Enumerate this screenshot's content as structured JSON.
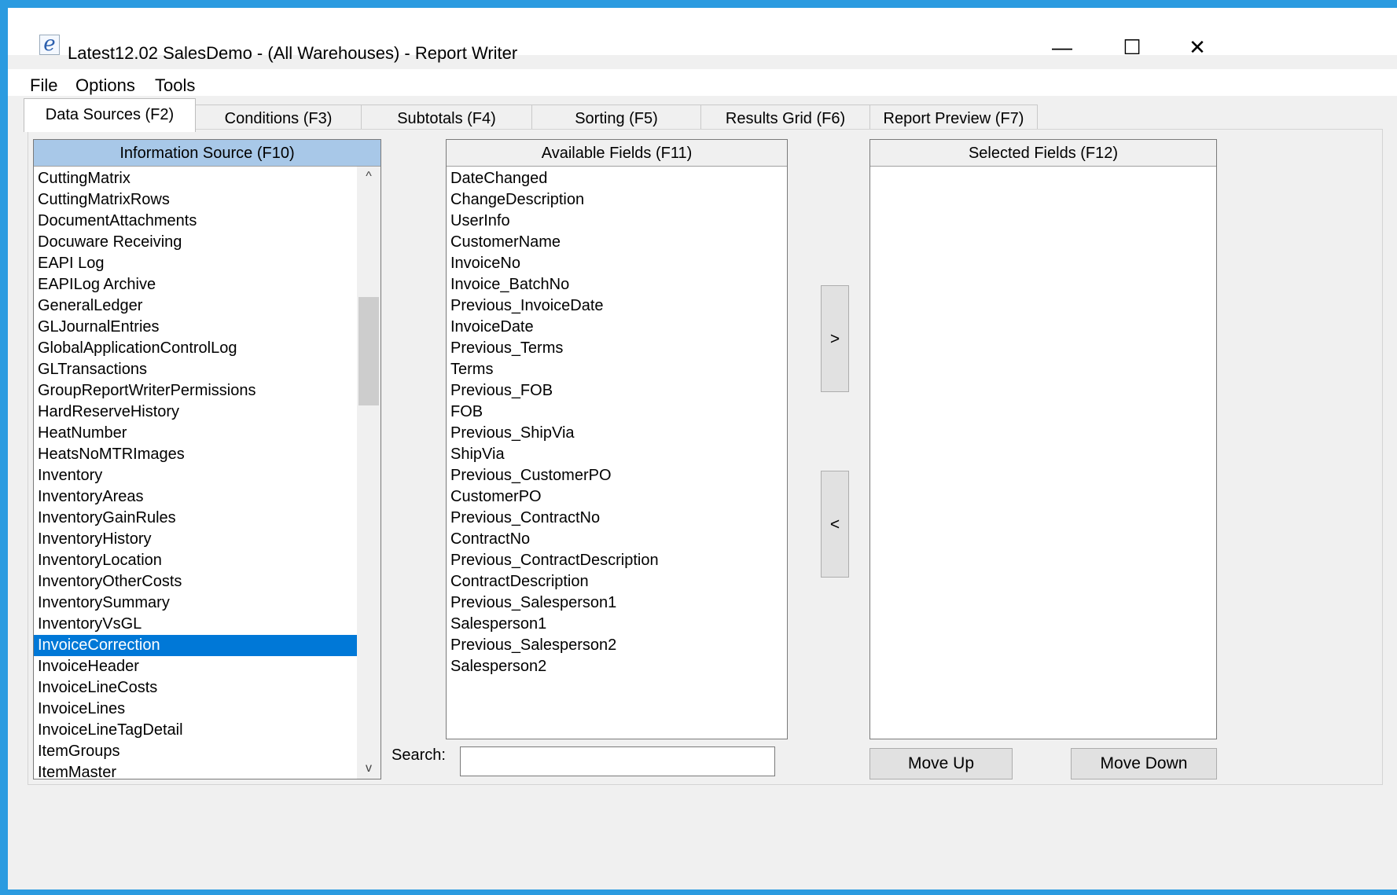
{
  "window": {
    "title": "Latest12.02 SalesDemo - (All Warehouses) - Report Writer",
    "app_icon_glyph": "e",
    "minimize_glyph": "—",
    "maximize_glyph": "☐",
    "close_glyph": "✕"
  },
  "menu": [
    "File",
    "Options",
    "Tools"
  ],
  "tabs": [
    {
      "label": "Data Sources (F2)",
      "active": true
    },
    {
      "label": "Conditions (F3)",
      "active": false
    },
    {
      "label": "Subtotals (F4)",
      "active": false
    },
    {
      "label": "Sorting (F5)",
      "active": false
    },
    {
      "label": "Results Grid (F6)",
      "active": false
    },
    {
      "label": "Report Preview (F7)",
      "active": false
    }
  ],
  "info_source": {
    "header": "Information Source (F10)",
    "selected": "InvoiceCorrection",
    "items": [
      "CuttingMatrix",
      "CuttingMatrixRows",
      "DocumentAttachments",
      "Docuware Receiving",
      "EAPI Log",
      "EAPILog Archive",
      "GeneralLedger",
      "GLJournalEntries",
      "GlobalApplicationControlLog",
      "GLTransactions",
      "GroupReportWriterPermissions",
      "HardReserveHistory",
      "HeatNumber",
      "HeatsNoMTRImages",
      "Inventory",
      "InventoryAreas",
      "InventoryGainRules",
      "InventoryHistory",
      "InventoryLocation",
      "InventoryOtherCosts",
      "InventorySummary",
      "InventoryVsGL",
      "InvoiceCorrection",
      "InvoiceHeader",
      "InvoiceLineCosts",
      "InvoiceLines",
      "InvoiceLineTagDetail",
      "ItemGroups",
      "ItemMaster"
    ],
    "scroll_up_glyph": "^",
    "scroll_down_glyph": "v"
  },
  "available_fields": {
    "header": "Available Fields (F11)",
    "items": [
      "DateChanged",
      "ChangeDescription",
      "UserInfo",
      "CustomerName",
      "InvoiceNo",
      "Invoice_BatchNo",
      "Previous_InvoiceDate",
      "InvoiceDate",
      "Previous_Terms",
      "Terms",
      "Previous_FOB",
      "FOB",
      "Previous_ShipVia",
      "ShipVia",
      "Previous_CustomerPO",
      "CustomerPO",
      "Previous_ContractNo",
      "ContractNo",
      "Previous_ContractDescription",
      "ContractDescription",
      "Previous_Salesperson1",
      "Salesperson1",
      "Previous_Salesperson2",
      "Salesperson2"
    ]
  },
  "selected_fields": {
    "header": "Selected Fields (F12)",
    "items": []
  },
  "buttons": {
    "add": ">",
    "remove": "<",
    "move_up": "Move Up",
    "move_down": "Move Down"
  },
  "search": {
    "label": "Search:",
    "value": ""
  }
}
